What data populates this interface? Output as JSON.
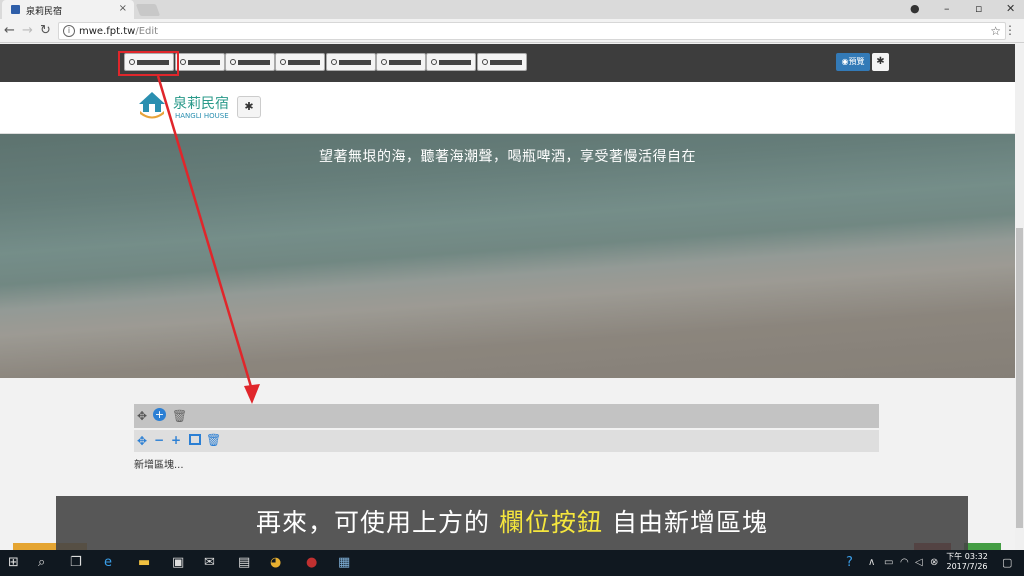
{
  "browser": {
    "tab_title": "泉莉民宿",
    "tab_close": "×",
    "url_host": "mwe.fpt.tw",
    "url_path": "/Edit"
  },
  "edit_toolbar": {
    "column_buttons": [
      "col-1",
      "col-2",
      "col-3",
      "col-4",
      "col-5",
      "col-6",
      "col-7",
      "col-8"
    ],
    "preview_label": "預覽",
    "gear_icon": "gear-icon"
  },
  "header": {
    "logo_title": "泉莉民宿",
    "logo_subtitle": "HANGLI HOUSE"
  },
  "hero": {
    "text": "望著無垠的海，聽著海潮聲，喝瓶啤酒，享受著慢活得自在"
  },
  "block": {
    "new_block_text": "新增區塊...",
    "icons_row1": [
      "move-icon",
      "add-circle-icon",
      "trash-icon"
    ],
    "icons_row2": [
      "move-icon",
      "minus-icon",
      "plus-icon",
      "image-icon",
      "trash-icon"
    ]
  },
  "caption": {
    "before": "再來，可使用上方的",
    "highlight": "欄位按鈕",
    "after": "自由新增區塊"
  },
  "taskbar": {
    "time": "下午 03:32",
    "date": "2017/7/26"
  },
  "colors": {
    "annotation_red": "#e0262b",
    "caption_highlight": "#f5e63d",
    "preview_blue": "#337ab7"
  }
}
